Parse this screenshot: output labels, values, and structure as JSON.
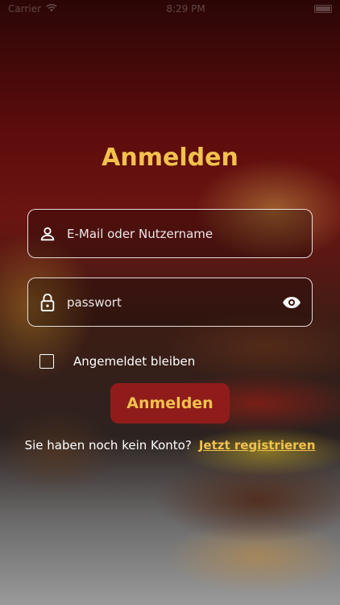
{
  "status_bar": {
    "carrier": "Carrier",
    "time": "8:29 PM",
    "wifi_icon": "wifi-icon",
    "battery_icon": "battery-icon"
  },
  "login": {
    "title": "Anmelden",
    "username": {
      "placeholder": "E-Mail oder Nutzername",
      "value": "",
      "icon": "user-icon"
    },
    "password": {
      "placeholder": "passwort",
      "value": "",
      "icon": "lock-icon",
      "toggle_icon": "eye-icon"
    },
    "remember_me": {
      "label": "Angemeldet bleiben",
      "checked": false
    },
    "submit_label": "Anmelden",
    "register_prompt": "Sie haben noch kein Konto?",
    "register_link": "Jetzt registrieren"
  },
  "colors": {
    "accent": "#f2c14e",
    "button_bg": "#8f1c1a",
    "border": "#ffffff"
  }
}
